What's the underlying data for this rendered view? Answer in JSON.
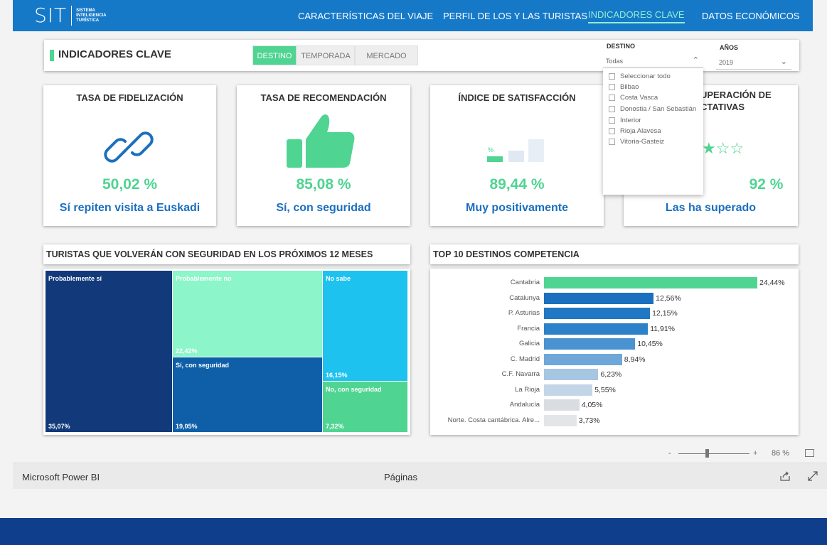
{
  "logo": {
    "main": "SIT",
    "sub1": "SISTEMA",
    "sub2": "INTELIGENCIA",
    "sub3": "TURÍSTICA"
  },
  "nav": [
    "CARACTERÍSTICAS DEL VIAJE",
    "PERFIL DE LOS Y LAS TURISTAS",
    "INDICADORES CLAVE",
    "DATOS ECONÓMICOS"
  ],
  "header": {
    "title": "INDICADORES CLAVE",
    "tabs": [
      "DESTINO",
      "TEMPORADA",
      "MERCADO"
    ]
  },
  "filters": {
    "destino_label": "DESTINO",
    "destino_value": "Todas",
    "anos_label": "AÑOS",
    "anos_value": "2019",
    "options": [
      "Seleccionar todo",
      "Bilbao",
      "Costa Vasca",
      "Donostia / San Sebastián",
      "Interior",
      "Rioja Alavesa",
      "Vitoria-Gasteiz"
    ]
  },
  "kpis": [
    {
      "title": "TASA DE FIDELIZACIÓN",
      "value": "50,02 %",
      "sub": "Sí repiten visita a Euskadi",
      "icon": "link-icon"
    },
    {
      "title": "TASA DE RECOMENDACIÓN",
      "value": "85,08 %",
      "sub": "Sí, con seguridad",
      "icon": "thumbs-up-icon"
    },
    {
      "title": "ÍNDICE DE SATISFACCIÓN",
      "value": "89,44 %",
      "sub": "Muy positivamente",
      "icon": "bar-level-icon"
    },
    {
      "title": "UPERACIÓN DE",
      "title2": "CTATIVAS",
      "value": "92 %",
      "sub": "Las ha superado",
      "icon": "stars-icon",
      "stars_filled": 1,
      "stars_total": 3
    }
  ],
  "treemap": {
    "title": "TURISTAS QUE VOLVERÁN CON SEGURIDAD EN LOS PRÓXIMOS 12 MESES",
    "cells": [
      {
        "label": "Probablemente sí",
        "value": "35,07%",
        "color": "#12397a"
      },
      {
        "label": "Probablemente no",
        "value": "22,42%",
        "color": "#8cf5c9"
      },
      {
        "label": "Sí, con seguridad",
        "value": "19,05%",
        "color": "#0f5fa8"
      },
      {
        "label": "No sabe",
        "value": "16,15%",
        "color": "#1ec2ef"
      },
      {
        "label": "No, con seguridad",
        "value": "7,32%",
        "color": "#4fd492"
      }
    ]
  },
  "competencia": {
    "title": "TOP 10 DESTINOS COMPETENCIA",
    "items": [
      {
        "name": "Cantabria",
        "value": 24.44,
        "label": "24,44%",
        "color": "#4fd492"
      },
      {
        "name": "Catalunya",
        "value": 12.56,
        "label": "12,56%",
        "color": "#1b6fbf"
      },
      {
        "name": "P. Asturias",
        "value": 12.15,
        "label": "12,15%",
        "color": "#2077c4"
      },
      {
        "name": "Francia",
        "value": 11.91,
        "label": "11,91%",
        "color": "#2c81c9"
      },
      {
        "name": "Galicia",
        "value": 10.45,
        "label": "10,45%",
        "color": "#4a92d0"
      },
      {
        "name": "C. Madrid",
        "value": 8.94,
        "label": "8,94%",
        "color": "#6ea7d8"
      },
      {
        "name": "C.F. Navarra",
        "value": 6.23,
        "label": "6,23%",
        "color": "#a6c6e2"
      },
      {
        "name": "La Rioja",
        "value": 5.55,
        "label": "5,55%",
        "color": "#c2d6e8"
      },
      {
        "name": "Andalucía",
        "value": 4.05,
        "label": "4,05%",
        "color": "#d9dde1"
      },
      {
        "name": "Norte. Costa cantábrica. Alre...",
        "value": 3.73,
        "label": "3,73%",
        "color": "#e3e5e7"
      }
    ]
  },
  "zoom": {
    "minus": "-",
    "plus": "+",
    "value": "86 %"
  },
  "footer": {
    "brand": "Microsoft Power BI",
    "pages": "Páginas"
  }
}
